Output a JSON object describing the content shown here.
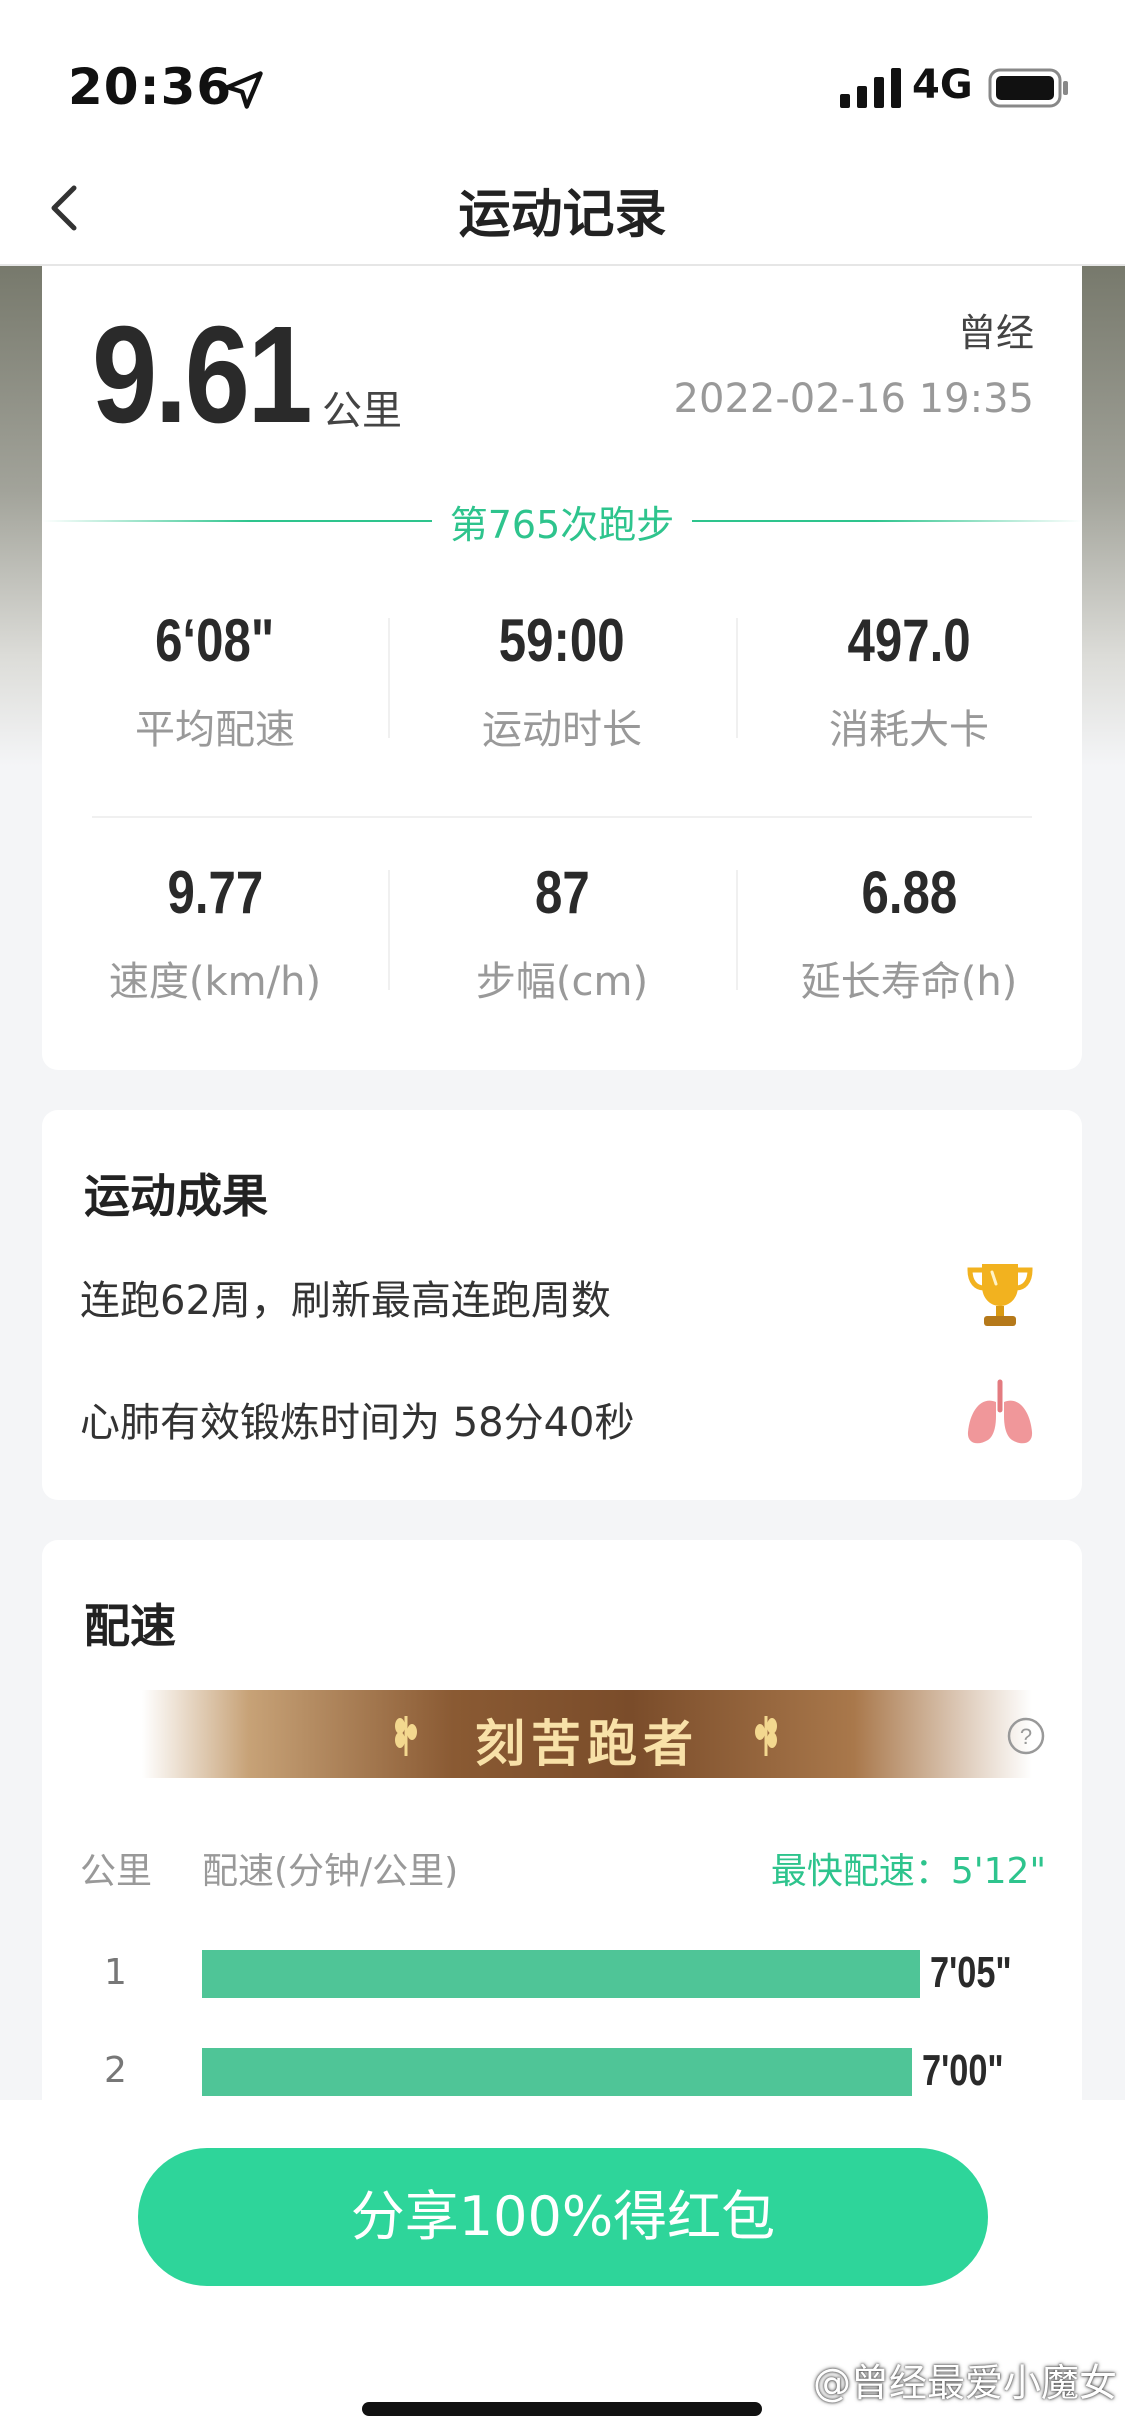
{
  "status_bar": {
    "time": "20:36",
    "network": "4G"
  },
  "nav": {
    "title": "运动记录"
  },
  "summary": {
    "distance": "9.61",
    "distance_unit": "公里",
    "user_name": "曾经",
    "datetime": "2022-02-16 19:35",
    "run_count": "第765次跑步",
    "stats": [
      {
        "value": "6‘08\"",
        "label": "平均配速"
      },
      {
        "value": "59:00",
        "label": "运动时长"
      },
      {
        "value": "497.0",
        "label": "消耗大卡"
      },
      {
        "value": "9.77",
        "label": "速度(km/h)"
      },
      {
        "value": "87",
        "label": "步幅(cm)"
      },
      {
        "value": "6.88",
        "label": "延长寿命(h)"
      }
    ]
  },
  "achievements": {
    "title": "运动成果",
    "items": [
      {
        "text": "连跑62周，刷新最高连跑周数",
        "icon": "trophy-icon"
      },
      {
        "text": "心肺有效锻炼时间为 58分40秒",
        "icon": "lungs-icon"
      }
    ]
  },
  "pace": {
    "title": "配速",
    "badge": "刻苦跑者",
    "col_km": "公里",
    "col_pace": "配速(分钟/公里)",
    "fastest": "最快配速：5'12\"",
    "rows": [
      {
        "km": "1",
        "pace": "7'05\"",
        "fill": 0.92
      },
      {
        "km": "2",
        "pace": "7'00\"",
        "fill": 0.91
      }
    ]
  },
  "action": {
    "share_label": "分享100%得红包"
  },
  "watermark": "@曾经最爱小魔女",
  "colors": {
    "accent": "#2ec48d",
    "button": "#2ed59a",
    "bar": "#4fc597"
  }
}
